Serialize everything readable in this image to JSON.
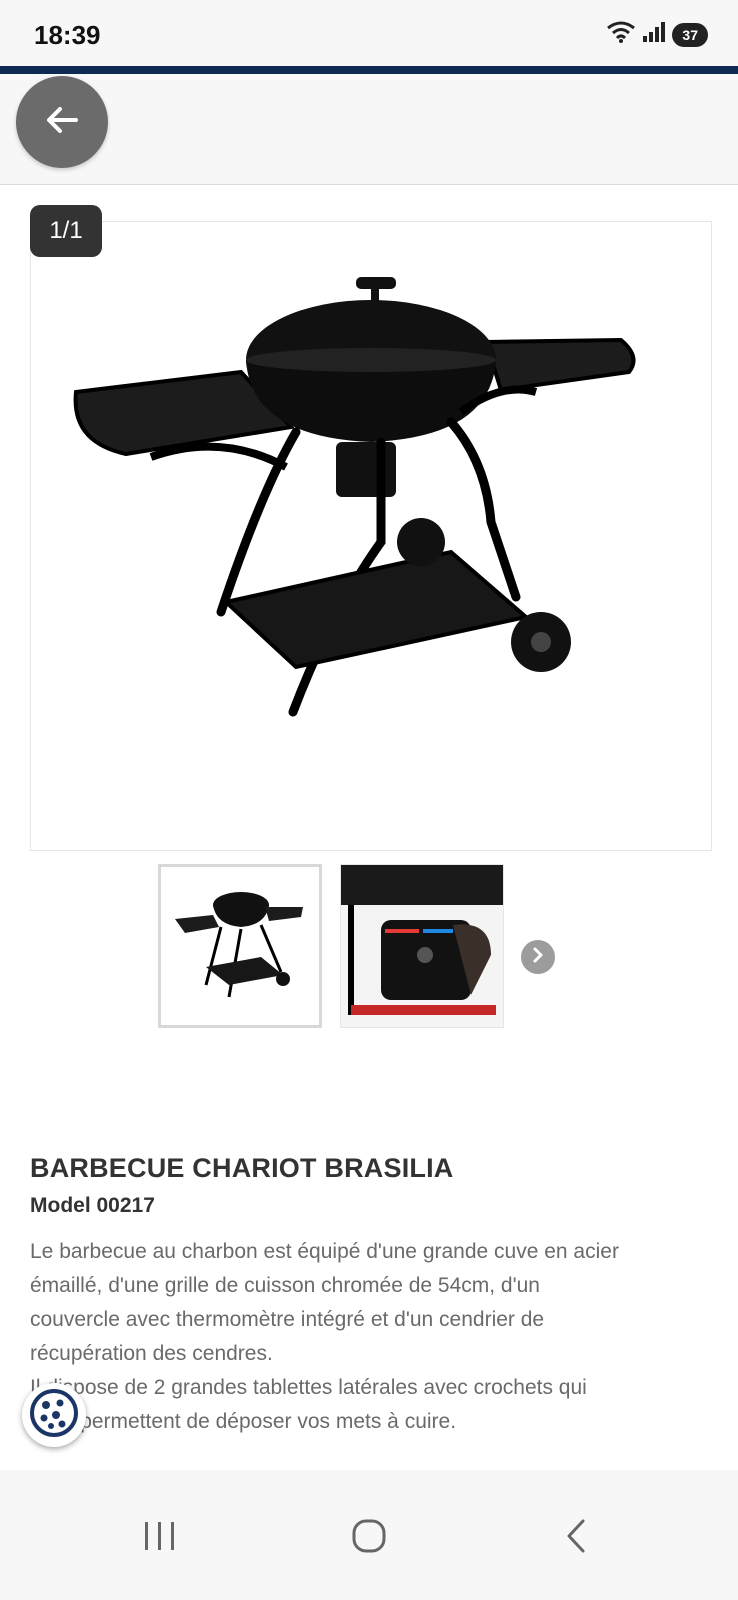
{
  "status_bar": {
    "time": "18:39",
    "battery": "37",
    "icons": [
      "wifi-icon",
      "signal-icon",
      "battery-icon"
    ]
  },
  "header": {
    "back_icon": "arrow-left-icon"
  },
  "gallery": {
    "counter": "1/1",
    "main_image": "barbecue-chariot-image",
    "thumbnails": [
      "barbecue-chariot-thumbnail",
      "ash-drawer-detail-thumbnail"
    ],
    "next_icon": "chevron-right-icon"
  },
  "product": {
    "title": "BARBECUE CHARIOT BRASILIA",
    "model": "Model 00217",
    "description_lines": [
      "Le barbecue au charbon est équipé d'une grande cuve en acier",
      "émaillé, d'une grille de cuisson chromée de 54cm, d'un",
      "couvercle avec thermomètre intégré et d'un cendrier de",
      "récupération des cendres.",
      "Il dispose de 2 grandes tablettes latérales avec crochets qui",
      "vous permettent de déposer vos mets à cuire."
    ]
  },
  "cookie": {
    "icon": "cookie-icon"
  },
  "system_nav": {
    "recents_icon": "recents-icon",
    "home_icon": "home-icon",
    "back_icon": "back-chevron-icon"
  },
  "colors": {
    "accent_bar": "#0f2a52",
    "back_button": "#6b6b6b",
    "text_dark": "#333333",
    "text_muted": "#6a6a6a"
  }
}
